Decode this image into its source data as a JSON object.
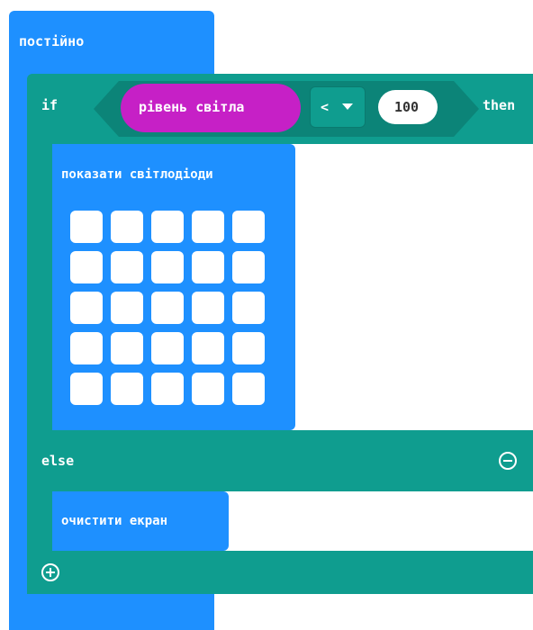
{
  "forever": {
    "label": "постійно"
  },
  "if_block": {
    "if_label": "if",
    "then_label": "then",
    "else_label": "else",
    "remove_else_icon": "minus-circle-icon",
    "add_branch_icon": "plus-circle-icon"
  },
  "condition": {
    "sensor_label": "рівень світла",
    "operator": "<",
    "dropdown_icon": "caret-down-icon",
    "value": "100"
  },
  "show_leds": {
    "label": "показати світлодіоди",
    "grid": [
      [
        0,
        0,
        0,
        0,
        0
      ],
      [
        0,
        0,
        0,
        0,
        0
      ],
      [
        0,
        0,
        0,
        0,
        0
      ],
      [
        0,
        0,
        0,
        0,
        0
      ],
      [
        0,
        0,
        0,
        0,
        0
      ]
    ]
  },
  "clear_screen": {
    "label": "очистити екран"
  },
  "colors": {
    "forever_blue": "#1e90ff",
    "logic_teal": "#0f9d8f",
    "input_magenta": "#c620c6",
    "led_off": "#ffffff"
  }
}
